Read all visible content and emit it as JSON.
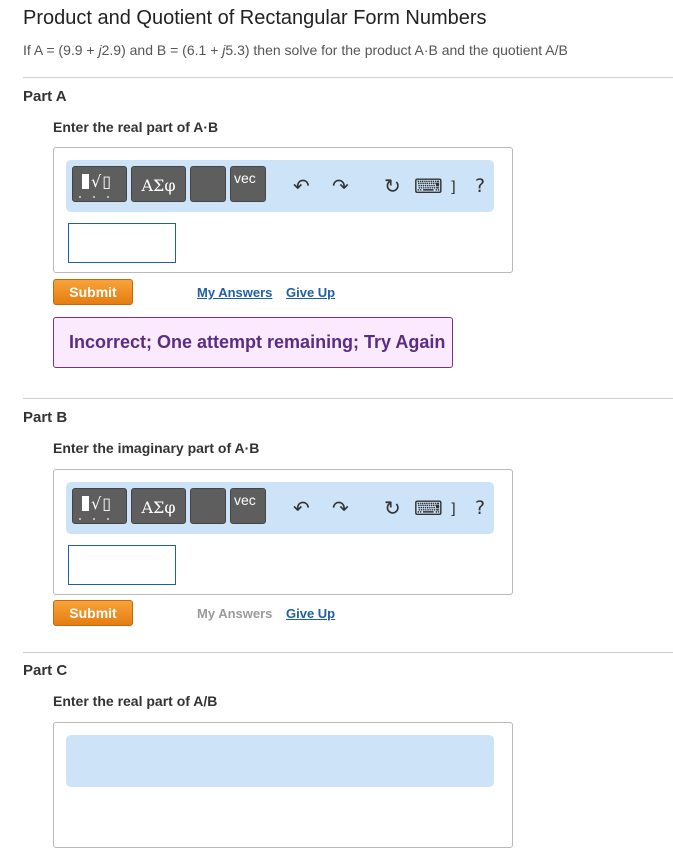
{
  "title": "Product and Quotient of Rectangular Form Numbers",
  "problem": {
    "p1": "If A = (9.9 + ",
    "j1": "j",
    "p2": "2.9) and B = (6.1 + ",
    "j2": "j",
    "p3": "5.3) then solve for the product A·B and the quotient A/B"
  },
  "toolbar": {
    "greek_label": "ΑΣφ",
    "vec_label": "vec",
    "undo_icon": "↶",
    "redo_icon": "↷",
    "reset_icon": "↻",
    "keyboard_icon": "⌨",
    "shortcuts_label": "]",
    "help_label": "?"
  },
  "parts": [
    {
      "title": "Part A",
      "prompt": "Enter the real part of A·B",
      "submit": "Submit",
      "my_answers": "My Answers",
      "give_up": "Give Up",
      "feedback": "Incorrect; One attempt remaining; Try Again"
    },
    {
      "title": "Part B",
      "prompt": "Enter the imaginary part of A·B",
      "submit": "Submit",
      "my_answers": "My Answers",
      "give_up": "Give Up"
    },
    {
      "title": "Part C",
      "prompt": "Enter the real part of A/B"
    }
  ],
  "colors": {
    "toolbar_bg": "#cde3f8",
    "submit_orange": "#f0901f",
    "link_blue": "#1f5fa8",
    "feedback_purple": "#5b2c83",
    "feedback_bg": "#fbeafd"
  }
}
